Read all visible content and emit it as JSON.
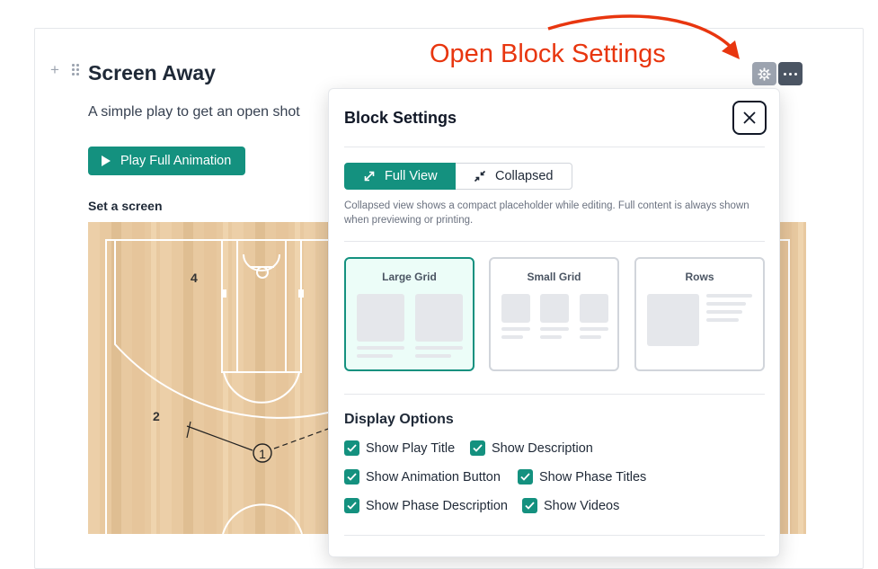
{
  "annotation": {
    "label": "Open Block Settings",
    "color": "#e8360f"
  },
  "block": {
    "title": "Screen Away",
    "description": "A simple play to get an open shot",
    "animation_button_label": "Play Full Animation",
    "phase_title": "Set a screen",
    "court_labels": {
      "player_4": "4",
      "player_2": "2",
      "player_1": "1"
    }
  },
  "toolbar": {
    "settings_icon": "gear-icon",
    "more_icon": "more-horizontal-icon"
  },
  "settings_panel": {
    "title": "Block Settings",
    "view_modes": [
      {
        "label": "Full View",
        "icon": "expand-icon",
        "active": true
      },
      {
        "label": "Collapsed",
        "icon": "collapse-icon",
        "active": false
      }
    ],
    "view_help": "Collapsed view shows a compact placeholder while editing. Full content is always shown when previewing or printing.",
    "layouts": [
      {
        "label": "Large Grid",
        "selected": true
      },
      {
        "label": "Small Grid",
        "selected": false
      },
      {
        "label": "Rows",
        "selected": false
      }
    ],
    "display_options_heading": "Display Options",
    "display_options": [
      {
        "label": "Show Play Title",
        "checked": true
      },
      {
        "label": "Show Description",
        "checked": true
      },
      {
        "label": "Show Animation Button",
        "checked": true
      },
      {
        "label": "Show Phase Titles",
        "checked": true
      },
      {
        "label": "Show Phase Description",
        "checked": true
      },
      {
        "label": "Show Videos",
        "checked": true
      }
    ]
  },
  "colors": {
    "accent": "#14917f",
    "court_wood": "#e8c9a0",
    "court_lines": "#ffffff"
  }
}
